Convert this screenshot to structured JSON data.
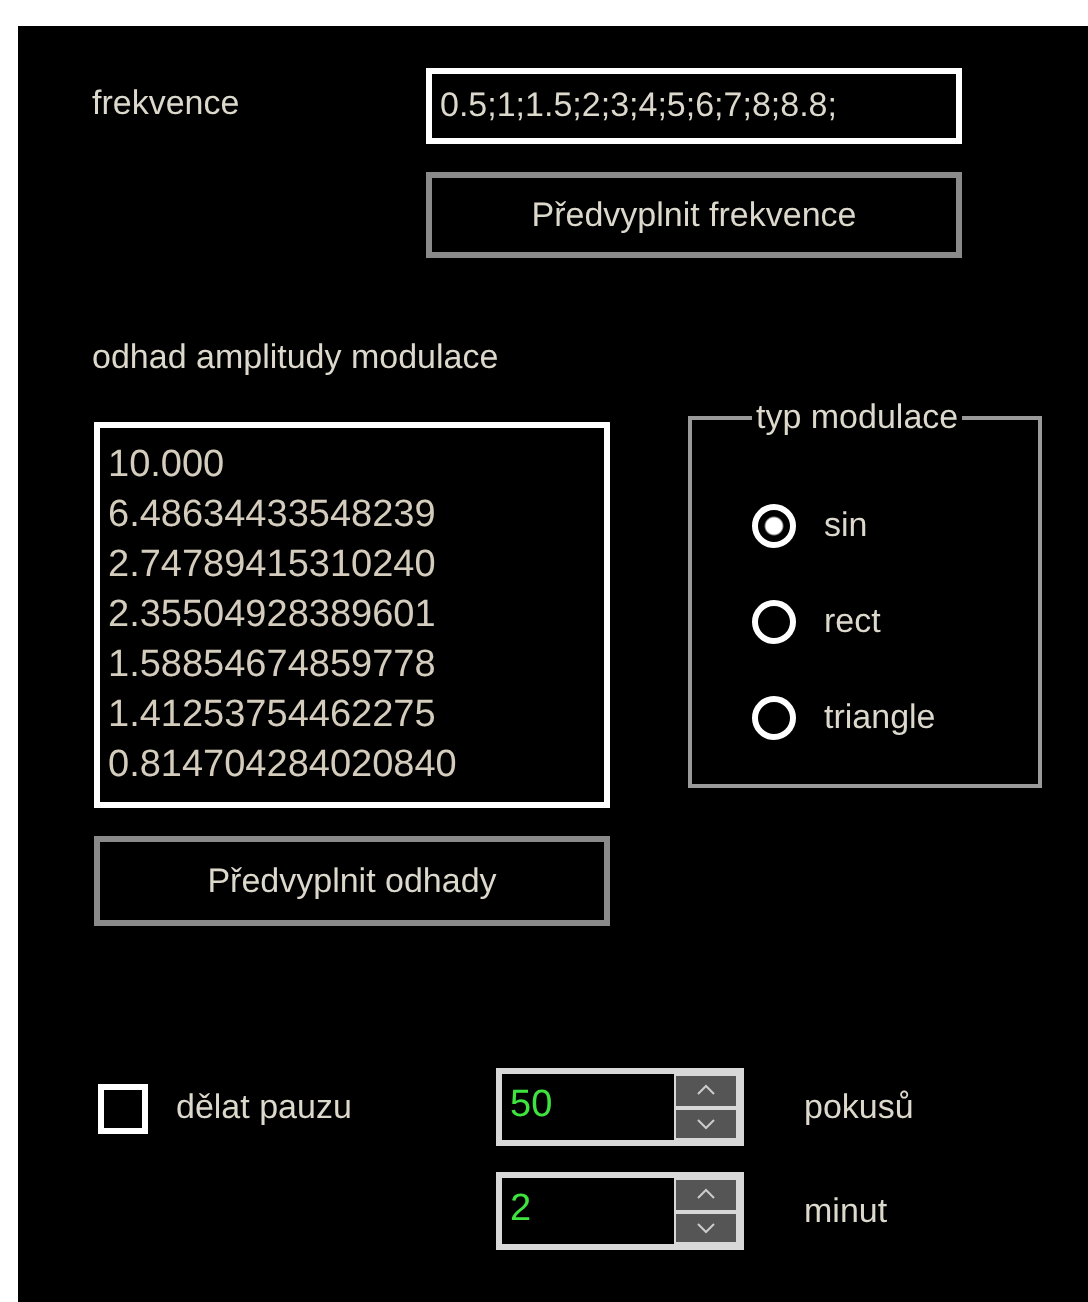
{
  "frequency": {
    "label": "frekvence",
    "value": "0.5;1;1.5;2;3;4;5;6;7;8;8.8;",
    "button": "Předvyplnit frekvence"
  },
  "estimate": {
    "label": "odhad amplitudy modulace",
    "lines": [
      "10.000",
      "6.48634433548239",
      "2.74789415310240",
      "2.35504928389601",
      "1.58854674859778",
      "1.41253754462275",
      "0.814704284020840"
    ],
    "button": "Předvyplnit odhady"
  },
  "modulation": {
    "title": "typ modulace",
    "options": [
      {
        "label": "sin",
        "selected": true
      },
      {
        "label": "rect",
        "selected": false
      },
      {
        "label": "triangle",
        "selected": false
      }
    ]
  },
  "pause": {
    "label": "dělat pauzu",
    "checked": false
  },
  "spinners": [
    {
      "value": "50",
      "unit": "pokusů"
    },
    {
      "value": "2",
      "unit": "minut"
    }
  ]
}
